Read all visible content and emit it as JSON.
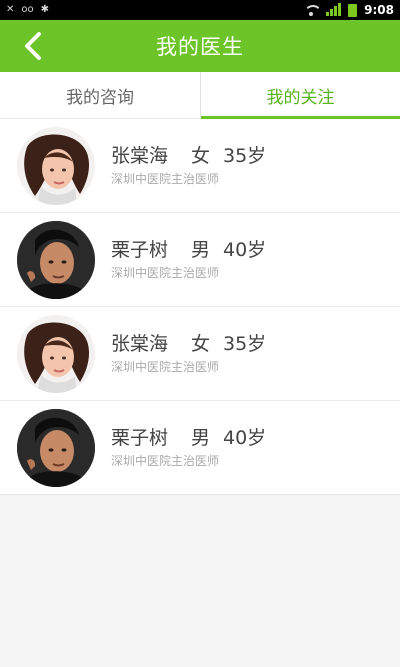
{
  "statusBar": {
    "time": "9:08",
    "icons": [
      "mute-icon",
      "voicemail-icon",
      "bluetooth-icon",
      "wifi-icon",
      "signal-icon",
      "battery-icon"
    ]
  },
  "header": {
    "title": "我的医生",
    "background": "#6cc428",
    "backIcon": "chevron-left-icon"
  },
  "tabs": [
    {
      "label": "我的咨询",
      "active": false
    },
    {
      "label": "我的关注",
      "active": true
    }
  ],
  "doctors": [
    {
      "name": "张棠海",
      "gender": "女",
      "age": "35岁",
      "title": "深圳中医院主治医师",
      "avatarIcon": "female-doctor-avatar"
    },
    {
      "name": "栗子树",
      "gender": "男",
      "age": "40岁",
      "title": "深圳中医院主治医师",
      "avatarIcon": "male-doctor-avatar"
    },
    {
      "name": "张棠海",
      "gender": "女",
      "age": "35岁",
      "title": "深圳中医院主治医师",
      "avatarIcon": "female-doctor-avatar"
    },
    {
      "name": "栗子树",
      "gender": "男",
      "age": "40岁",
      "title": "深圳中医院主治医师",
      "avatarIcon": "male-doctor-avatar"
    }
  ],
  "colors": {
    "accent": "#6cc428",
    "activeTabText": "#58b41f",
    "background": "#f5f5f5"
  }
}
